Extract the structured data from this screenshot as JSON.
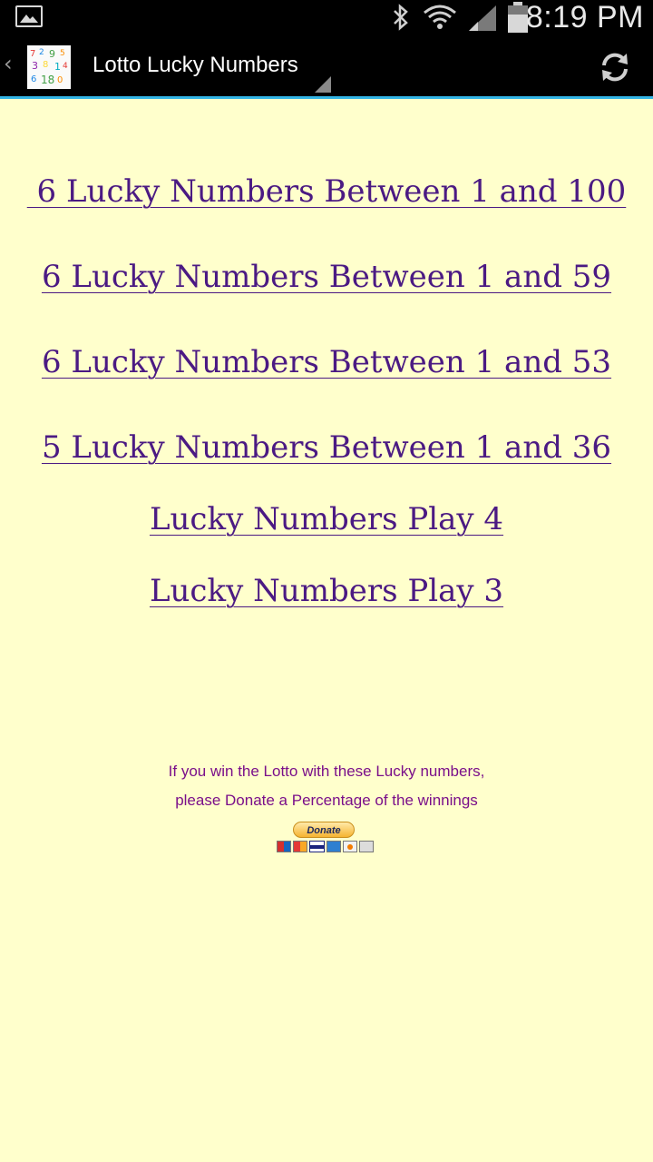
{
  "status_bar": {
    "time": "8:19 PM",
    "icons": [
      "gallery-icon",
      "bluetooth-icon",
      "wifi-icon",
      "signal-icon",
      "battery-icon"
    ]
  },
  "action_bar": {
    "title": "Lotto Lucky Numbers",
    "icons": [
      "up-chevron-icon",
      "app-logo",
      "dropdown-triangle-icon",
      "refresh-icon"
    ],
    "accent_color": "#33b5e5"
  },
  "links": [
    {
      "label": " 6 Lucky Numbers Between 1 and 100"
    },
    {
      "label": "6 Lucky Numbers Between 1 and 59"
    },
    {
      "label": "6 Lucky Numbers Between 1 and 53"
    },
    {
      "label": "5 Lucky Numbers Between 1 and 36"
    },
    {
      "label": "Lucky Numbers Play 4"
    },
    {
      "label": "Lucky Numbers Play 3"
    }
  ],
  "donate": {
    "line1": "If you win the Lotto with these Lucky numbers,",
    "line2": "please Donate a Percentage of the winnings",
    "button_label": "Donate"
  },
  "colors": {
    "background": "#ffffcc",
    "link": "#4b1a83",
    "donate_text": "#7a0f8a"
  }
}
